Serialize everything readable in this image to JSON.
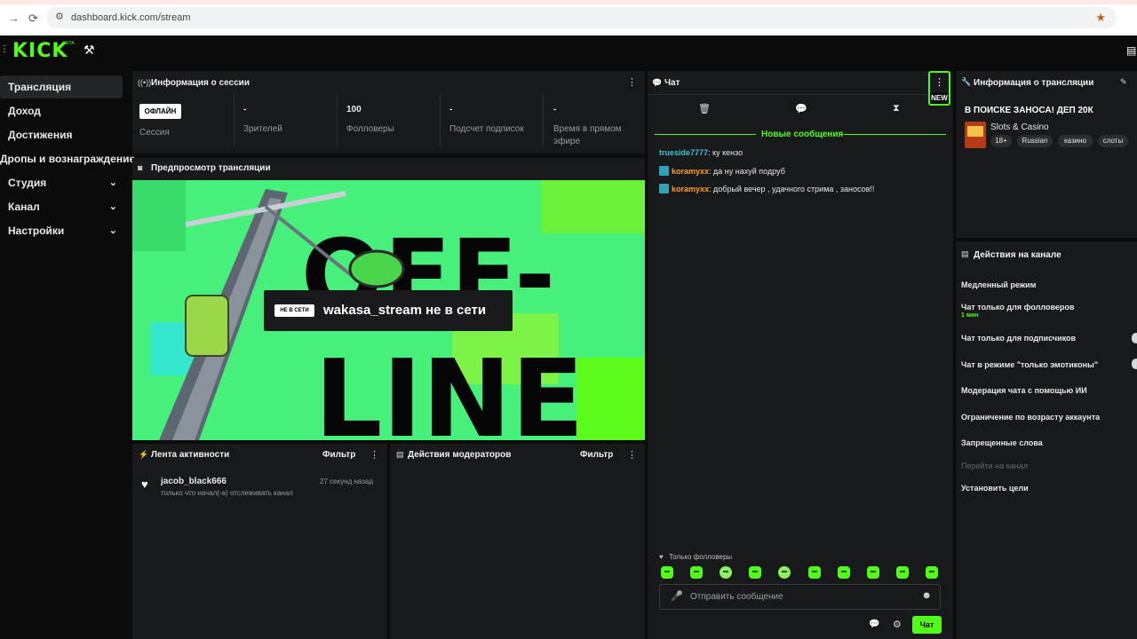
{
  "browser": {
    "url": "dashboard.kick.com/stream"
  },
  "app": {
    "logo": "KICK",
    "logo_badge": "BETA"
  },
  "sidebar": {
    "items": [
      {
        "label": "Трансляция"
      },
      {
        "label": "Доход"
      },
      {
        "label": "Достижения"
      },
      {
        "label": "Дропы и вознаграждение"
      },
      {
        "label": "Студия"
      },
      {
        "label": "Канал"
      },
      {
        "label": "Настройки"
      }
    ]
  },
  "session": {
    "title": "Информация о сессии",
    "status_badge": "ОФЛАЙН",
    "stats": [
      {
        "value": "",
        "label": "Сессия"
      },
      {
        "value": "-",
        "label": "Зрителей"
      },
      {
        "value": "100",
        "label": "Фолловеры"
      },
      {
        "value": "-",
        "label": "Подсчет подписок"
      },
      {
        "value": "-",
        "label": "Время в прямом эфире"
      }
    ]
  },
  "preview": {
    "title": "Предпросмотр трансляции",
    "badge": "НЕ В СЕТИ",
    "offline_text": "wakasa_stream не в сети",
    "art_text_top": "OFF-",
    "art_text_bottom": "LINE"
  },
  "activity": {
    "title": "Лента активности",
    "filter": "Фильтр",
    "items": [
      {
        "user": "jacob_black666",
        "time": "27 секунд назад",
        "text": "только что начал(-а) отслеживать канал"
      }
    ]
  },
  "mod_actions": {
    "title": "Действия модераторов",
    "filter": "Фильтр"
  },
  "chat": {
    "title": "Чат",
    "new_messages": "Новые сообщения",
    "messages": [
      {
        "user": "trueside7777",
        "text": ": ку кензо",
        "color": "#34c9d8",
        "badge": false
      },
      {
        "user": "koramyxx",
        "text": ": да ну нахуй подруб",
        "color": "#ff9f1a",
        "badge": true
      },
      {
        "user": "koramyxx",
        "text": ": добрый вечер , удачного стрима , заносов!!",
        "color": "#ff9f1a",
        "badge": true
      }
    ],
    "followers_only": "Только фолловеры",
    "input_placeholder": "Отправить сообщение",
    "send_label": "Чат",
    "new_label": "NEW"
  },
  "stream_info": {
    "title": "Информация о трансляции",
    "stream_title": "В ПОИСКЕ ЗАНОСА! ДЕП 20К",
    "category": "Slots & Casino",
    "tags": [
      "18+",
      "Russian",
      "казино",
      "слоты"
    ]
  },
  "channel_actions": {
    "title": "Действия на канале",
    "items": [
      {
        "label": "Медленный режим",
        "sub": ""
      },
      {
        "label": "Чат только для фолловеров",
        "sub": "1 мин"
      },
      {
        "label": "Чат только для подписчиков",
        "sub": ""
      },
      {
        "label": "Чат в режиме \"только эмотиконы\"",
        "sub": ""
      },
      {
        "label": "Модерация чата с помощью ИИ",
        "sub": ""
      },
      {
        "label": "Ограничение по возрасту аккаунта",
        "sub": ""
      },
      {
        "label": "Запрещенные слова",
        "sub": ""
      },
      {
        "label": "Перейти на канал",
        "sub": ""
      },
      {
        "label": "Установить цели",
        "sub": ""
      }
    ]
  },
  "colors": {
    "brand": "#53fc18",
    "panel": "#18191b",
    "background": "#0b0b0c"
  }
}
